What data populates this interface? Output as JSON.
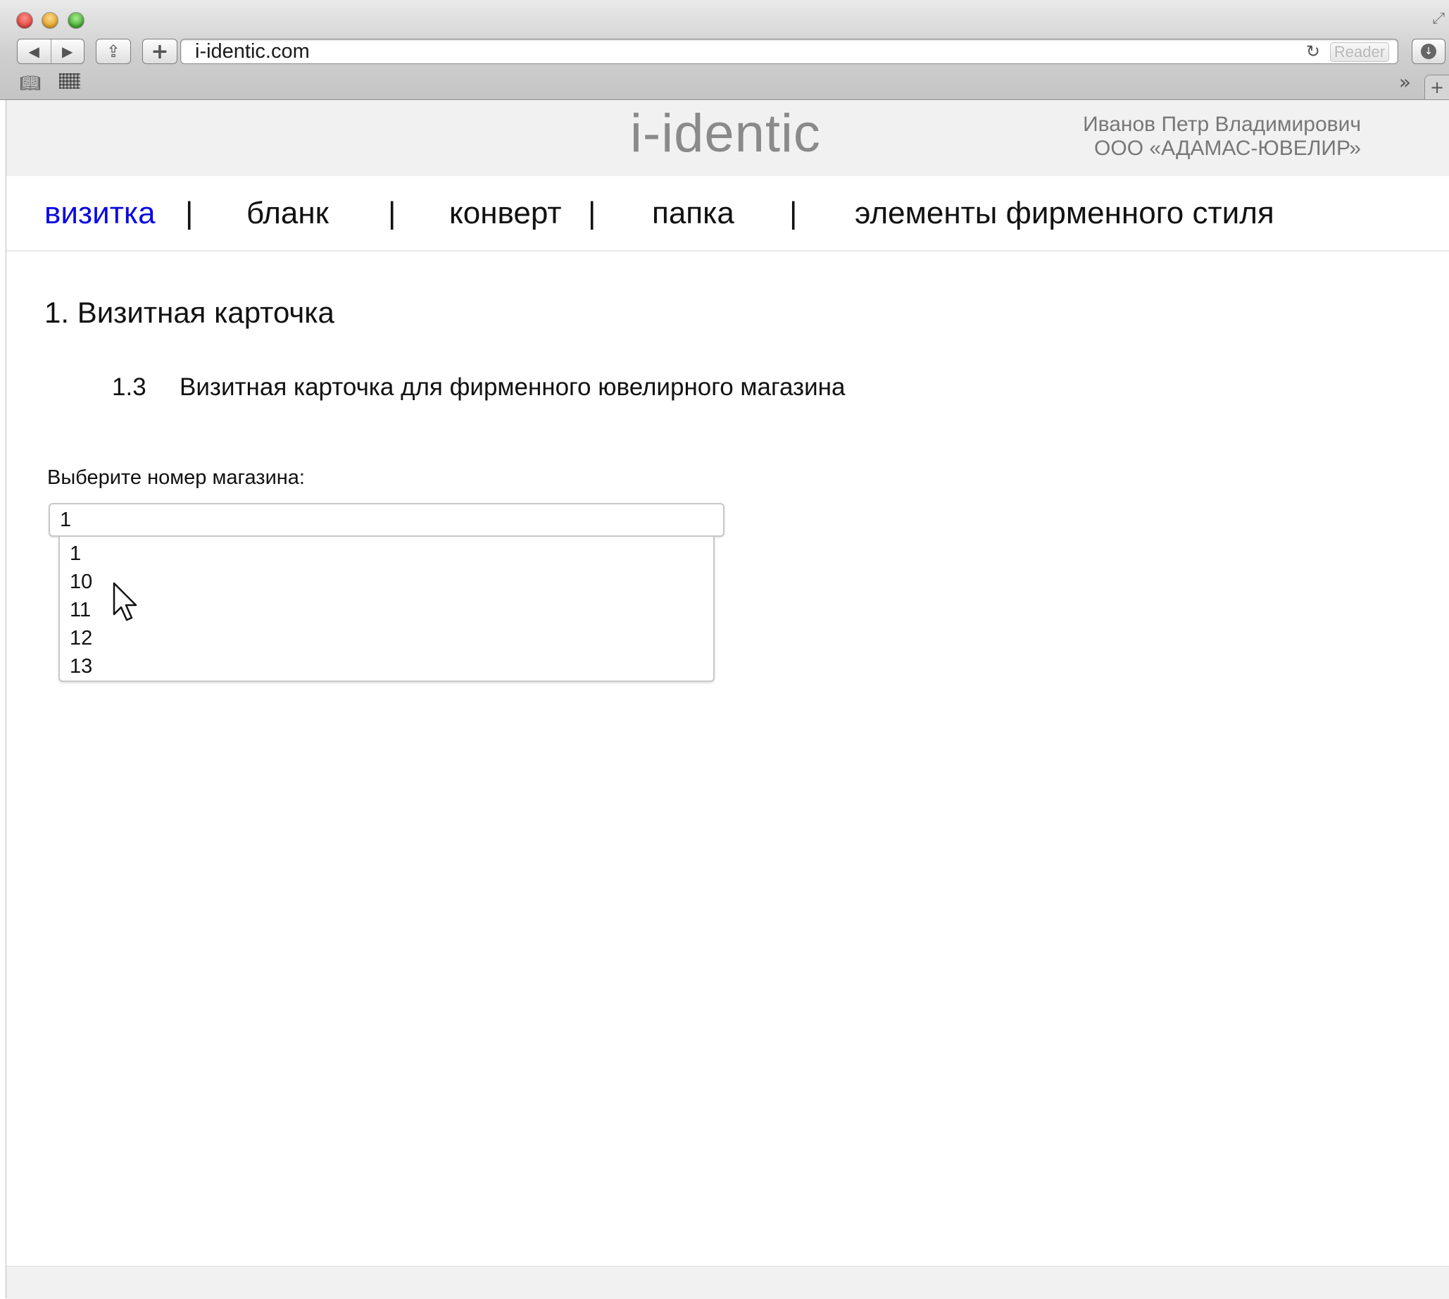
{
  "browser": {
    "url": "i-identic.com",
    "reader_label": "Reader",
    "icons": {
      "back": "back-arrow-icon",
      "forward": "forward-arrow-icon",
      "share": "share-icon",
      "add": "plus-icon",
      "reload": "reload-icon",
      "download": "download-icon",
      "bookmarks": "book-icon",
      "top_sites": "grid-icon",
      "more": "double-chevron-icon",
      "new_tab": "plus-icon",
      "resize": "fullscreen-icon"
    }
  },
  "header": {
    "logo": "i-identic",
    "user_name": "Иванов Петр Владимирович",
    "company": "ООО «АДАМАС-ЮВЕЛИР»"
  },
  "nav": {
    "items": [
      {
        "label": "визитка",
        "active": true
      },
      {
        "label": "бланк",
        "active": false
      },
      {
        "label": "конверт",
        "active": false
      },
      {
        "label": "папка",
        "active": false
      },
      {
        "label": "элементы фирменного стиля",
        "active": false
      }
    ],
    "separator": "|"
  },
  "content": {
    "section_title": "1. Визитная карточка",
    "subsection_number": "1.3",
    "subsection_title": "Визитная карточка для фирменного ювелирного магазина",
    "select_label": "Выберите номер магазина:",
    "select_value": "1",
    "options": [
      "1",
      "10",
      "11",
      "12",
      "13"
    ]
  },
  "colors": {
    "active_nav": "#0b0be0",
    "header_bg": "#f1f1f1",
    "logo": "#8a8a8a",
    "user_info": "#777777"
  }
}
